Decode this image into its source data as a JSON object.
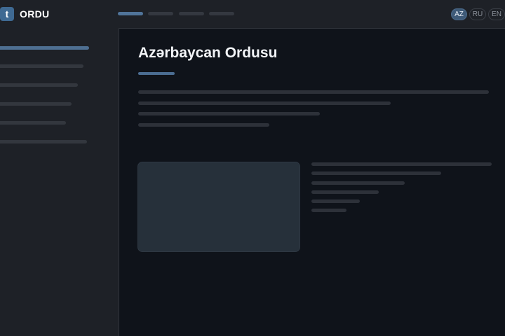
{
  "brand": {
    "logo_letter": "t",
    "name": "ORDU"
  },
  "header": {
    "languages": [
      {
        "code": "AZ",
        "active": true
      },
      {
        "code": "RU",
        "active": false
      },
      {
        "code": "EN",
        "active": false
      }
    ]
  },
  "main": {
    "title": "Azərbaycan Ordusu"
  },
  "colors": {
    "accent": "#4e6f92",
    "background": "#0f131a",
    "panel": "#1e2127",
    "placeholder": "#2d3139",
    "media": "#26303a"
  }
}
